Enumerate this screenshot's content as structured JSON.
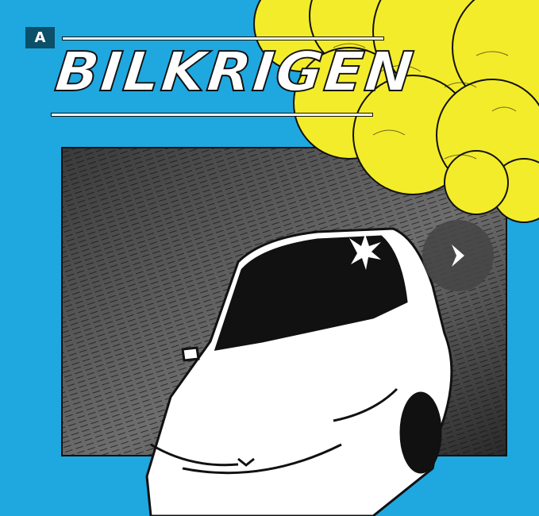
{
  "badge": {
    "label": "A"
  },
  "cover": {
    "title": "BILKRIGEN",
    "colors": {
      "background": "#1fa8e0",
      "smoke": "#f3ec2a",
      "ink": "#111111"
    }
  },
  "carousel": {
    "next_icon": "chevron-right-icon"
  }
}
